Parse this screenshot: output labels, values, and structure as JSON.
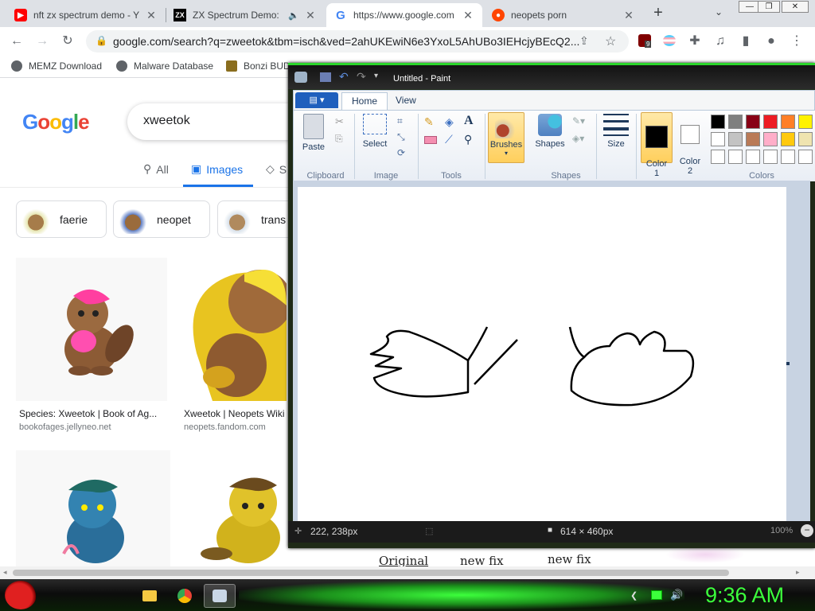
{
  "browser": {
    "tabs": [
      {
        "title": "nft zx spectrum demo - Y",
        "favicon": "youtube-icon",
        "color": "#ff0000"
      },
      {
        "title": "ZX Spectrum Demo:",
        "favicon": "zx-icon",
        "color": "#000000"
      },
      {
        "title": "https://www.google.com",
        "favicon": "google-icon",
        "color": "#4285f4"
      },
      {
        "title": "neopets porn",
        "favicon": "reddit-icon",
        "color": "#ff4500"
      }
    ],
    "url": "google.com/search?q=zweetok&tbm=isch&ved=2ahUKEwiN6e3YxoL5AhUBo3IEHcjyBEcQ2...",
    "bookmarks": [
      "MEMZ Download",
      "Malware Database",
      "Bonzi BUD"
    ],
    "extension_badge": "9"
  },
  "google": {
    "logo": "Google",
    "query": "xweetok",
    "tabs": [
      "All",
      "Images",
      "S"
    ],
    "chips": [
      "faerie",
      "neopet",
      "trans"
    ],
    "results": [
      {
        "caption": "Species: Xweetok | Book of Ag...",
        "source": "bookofages.jellyneo.net"
      },
      {
        "caption": "Xweetok | Neopets Wiki",
        "source": "neopets.fandom.com"
      }
    ],
    "peek_labels": [
      "Original",
      "new fix",
      "new fix"
    ]
  },
  "paint": {
    "title": "Untitled - Paint",
    "file_menu": "▤ ▾",
    "ribbon_tabs": [
      "Home",
      "View"
    ],
    "clipboard": {
      "paste": "Paste",
      "group": "Clipboard"
    },
    "image": {
      "select": "Select",
      "group": "Image"
    },
    "tools": {
      "group": "Tools"
    },
    "brushes": "Brushes",
    "shapes": {
      "label": "Shapes",
      "group": "Shapes"
    },
    "size": "Size",
    "color1": "Color\n1",
    "color2": "Color\n2",
    "colors_group": "Colors",
    "palette": [
      "#000000",
      "#7f7f7f",
      "#880015",
      "#ed1c24",
      "#ff7f27",
      "#fff200",
      "#ffffff",
      "#c3c3c3",
      "#b97a57",
      "#ffaec9",
      "#ffc90e",
      "#efe4b0",
      "#ffffff",
      "#ffffff",
      "#ffffff",
      "#ffffff",
      "#ffffff",
      "#ffffff"
    ],
    "status": {
      "cursor": "222, 238px",
      "size": "614 × 460px",
      "zoom": "100%"
    }
  },
  "taskbar": {
    "clock": "9:36 AM"
  }
}
